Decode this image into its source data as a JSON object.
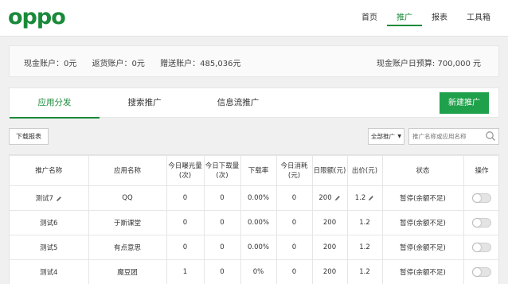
{
  "brand": {
    "logo_text": "oppo",
    "color": "#1a8a3a"
  },
  "nav": {
    "items": [
      "首页",
      "推广",
      "报表",
      "工具箱"
    ],
    "active_index": 1
  },
  "accounts": {
    "cash": "现金账户：0元",
    "rebate": "返货账户：0元",
    "gift": "赠送账户：485,036元",
    "daily_budget": "现金账户日预算: 700,000 元"
  },
  "tabs": {
    "items": [
      "应用分发",
      "搜索推广",
      "信息流推广"
    ],
    "active_index": 0
  },
  "buttons": {
    "new_promotion": "新建推广",
    "download_report": "下载报表"
  },
  "filter": {
    "selected": "全部推广"
  },
  "search": {
    "placeholder": "推广名称或应用名称"
  },
  "table": {
    "headers": [
      "推广名称",
      "应用名称",
      "今日曝光量(次)",
      "今日下载量(次)",
      "下载率",
      "今日消耗(元)",
      "日限额(元)",
      "出价(元)",
      "状态",
      "操作"
    ],
    "rows": [
      [
        "测试7",
        "QQ",
        "0",
        "0",
        "0.00%",
        "0",
        "200",
        "1.2",
        "暂停(余额不足)"
      ],
      [
        "测试6",
        "于斯课堂",
        "0",
        "0",
        "0.00%",
        "0",
        "200",
        "1.2",
        "暂停(余额不足)"
      ],
      [
        "测试5",
        "有点意思",
        "0",
        "0",
        "0.00%",
        "0",
        "200",
        "1.2",
        "暂停(余额不足)"
      ],
      [
        "测试4",
        "魔豆团",
        "1",
        "0",
        "0%",
        "0",
        "200",
        "1.2",
        "暂停(余额不足)"
      ]
    ],
    "toggle_state": "off"
  },
  "colors": {
    "accent": "#1a8a3a",
    "button": "#1fa04a"
  }
}
